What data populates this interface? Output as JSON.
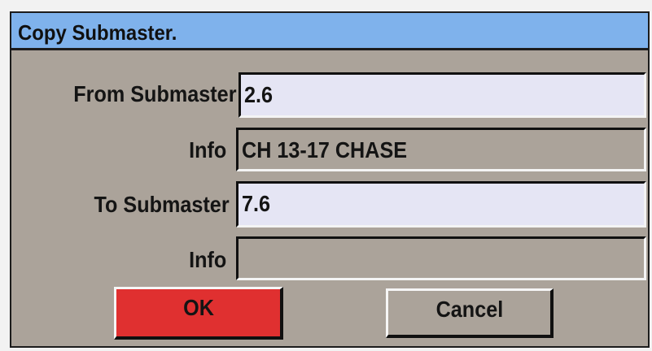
{
  "dialog": {
    "title": "Copy Submaster."
  },
  "form": {
    "from_label": "From Submaster",
    "from_value": "2.6",
    "from_info_label": "Info",
    "from_info_value": "CH 13-17 CHASE",
    "to_label": "To Submaster",
    "to_value": "7.6",
    "to_info_label": "Info",
    "to_info_value": ""
  },
  "buttons": {
    "ok_label": "OK",
    "cancel_label": "Cancel"
  },
  "colors": {
    "titlebar": "#7fb2ec",
    "dialog_background": "#aba39a",
    "editable_field": "#e5e5f4",
    "ok_button": "#e03030"
  }
}
